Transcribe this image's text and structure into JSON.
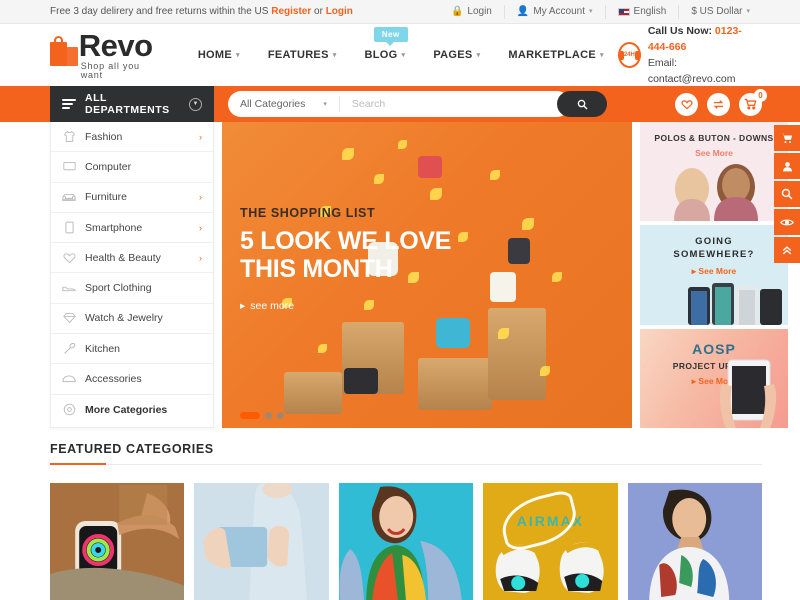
{
  "topbar": {
    "promo_prefix": "Free 3 day delirery and free returns within the US ",
    "register": "Register",
    "or": " or ",
    "login_link": "Login",
    "login": "Login",
    "my_account": "My Account",
    "language": "English",
    "currency": "$ US Dollar",
    "caret": "▾"
  },
  "header": {
    "logo_name": "Revo",
    "logo_tagline": "Shop all you want",
    "nav": [
      {
        "label": "HOME",
        "caret": "▾"
      },
      {
        "label": "FEATURES",
        "caret": "▾"
      },
      {
        "label": "BLOG",
        "caret": "▾"
      },
      {
        "label": "PAGES",
        "caret": "▾"
      },
      {
        "label": "MARKETPLACE",
        "caret": "▾"
      }
    ],
    "new_badge": "New",
    "headset_label": "24H",
    "call_label": "Call Us Now:",
    "call_number": "0123-444-666",
    "email_line": "Email: contact@revo.com"
  },
  "searchbar": {
    "departments": "ALL DEPARTMENTS",
    "dept_arrow": "▼",
    "category_selected": "All Categories",
    "category_caret": "▾",
    "search_placeholder": "Search",
    "search_value": "",
    "cart_count": "0"
  },
  "sidebar": {
    "items": [
      {
        "label": "Fashion",
        "icon": "shirt-icon",
        "glyph": "👕",
        "chevron": "›"
      },
      {
        "label": "Computer",
        "icon": "monitor-icon",
        "glyph": "▭",
        "chevron": ""
      },
      {
        "label": "Furniture",
        "icon": "sofa-icon",
        "glyph": "🛋",
        "chevron": "›"
      },
      {
        "label": "Smartphone",
        "icon": "phone-icon",
        "glyph": "▯",
        "chevron": "›"
      },
      {
        "label": "Health & Beauty",
        "icon": "heart-icon",
        "glyph": "♡",
        "chevron": "›"
      },
      {
        "label": "Sport Clothing",
        "icon": "shoe-icon",
        "glyph": "👟",
        "chevron": ""
      },
      {
        "label": "Watch & Jewelry",
        "icon": "diamond-icon",
        "glyph": "◇",
        "chevron": ""
      },
      {
        "label": "Kitchen",
        "icon": "utensil-icon",
        "glyph": "🔧",
        "chevron": ""
      },
      {
        "label": "Accessories",
        "icon": "hat-icon",
        "glyph": "⌒",
        "chevron": ""
      },
      {
        "label": "More Categories",
        "icon": "grid-icon",
        "glyph": "◎",
        "chevron": ""
      }
    ]
  },
  "hero": {
    "subtitle": "THE SHOPPING LIST",
    "title_line1": "5 LOOK WE LOVE",
    "title_line2": "THIS MONTH",
    "see_more": "see more",
    "arrow": "▸",
    "slides": 3,
    "active_slide": 1
  },
  "promos": [
    {
      "title": "POLOS & BUTON - DOWNS",
      "more": "See More",
      "arrow": ""
    },
    {
      "title": "GOING\nSOMEWHERE?",
      "more": "See More",
      "arrow": "▸"
    },
    {
      "title_big": "AOSP",
      "title": "PROJECT UPDATE",
      "more": "See More",
      "arrow": "▸"
    }
  ],
  "rail": [
    {
      "name": "cart-icon",
      "glyph": "🛒"
    },
    {
      "name": "user-icon",
      "glyph": "👤"
    },
    {
      "name": "search-icon",
      "glyph": "⌕"
    },
    {
      "name": "eye-icon",
      "glyph": "◉"
    },
    {
      "name": "scroll-top-icon",
      "glyph": "»"
    }
  ],
  "featured": {
    "title": "FEATURED CATEGORIES",
    "cards": [
      {
        "name": "smartwatch-card",
        "bg": "#a8713f"
      },
      {
        "name": "bag-card",
        "bg": "#cfe0ea"
      },
      {
        "name": "fashion-woman-card",
        "bg": "#2fbcd4"
      },
      {
        "name": "airmax-sneakers-card",
        "bg": "#e0ab16",
        "text": "AIRMAX"
      },
      {
        "name": "fashion-man-card",
        "bg": "#8b9dd4"
      }
    ]
  },
  "colors": {
    "accent": "#f4631e",
    "dark": "#2f3032",
    "badge": "#7fd6e8"
  }
}
